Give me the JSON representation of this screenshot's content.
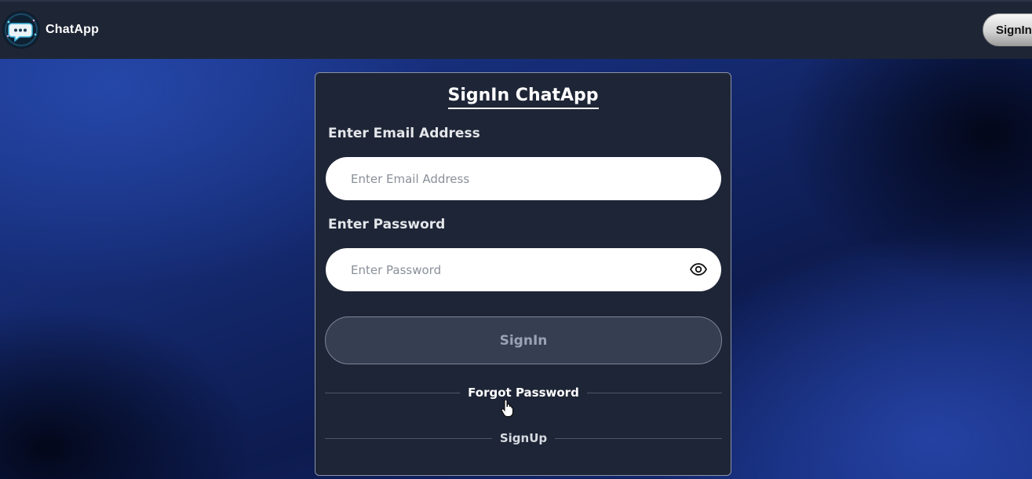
{
  "navbar": {
    "brand_name": "ChatApp",
    "logo_icon": "chat-bubble-logo-icon",
    "signin_label": "SignIn"
  },
  "card": {
    "title": "SignIn ChatApp",
    "email": {
      "label": "Enter Email Address",
      "placeholder": "Enter Email Address",
      "value": ""
    },
    "password": {
      "label": "Enter Password",
      "placeholder": "Enter Password",
      "value": "",
      "toggle_icon": "eye-icon"
    },
    "signin_button": "SignIn",
    "forgot_password_link": "Forgot Password",
    "signup_link": "SignUp"
  },
  "colors": {
    "navbar_bg": "#1e2535",
    "card_bg": "#1e2536",
    "button_bg": "#363f51",
    "background_blue": "#1c3890"
  }
}
